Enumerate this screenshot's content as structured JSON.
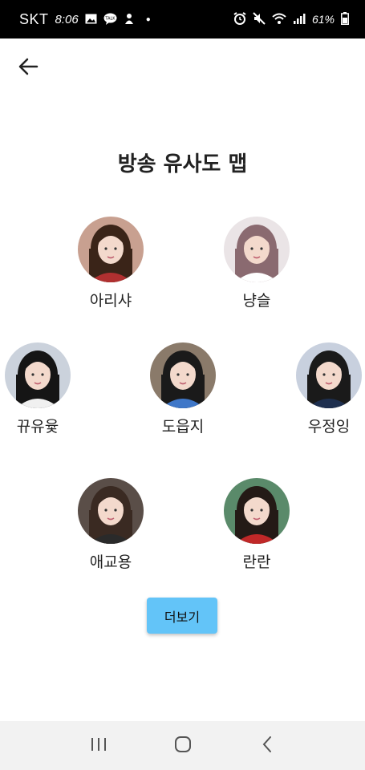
{
  "status_bar": {
    "carrier": "SKT",
    "time": "8:06",
    "battery_text": "61%",
    "left_icons": [
      "image-icon",
      "kakaotalk-icon",
      "notification-app-icon"
    ],
    "right_icons": [
      "alarm-icon",
      "mute-icon",
      "wifi-icon",
      "signal-icon",
      "battery-icon"
    ]
  },
  "header": {
    "back_icon": "arrow-left-icon"
  },
  "page": {
    "title": "방송 유사도 맵"
  },
  "streamers": [
    {
      "name": "아리샤",
      "hair": "#3a2418",
      "bg": "#c8a090",
      "accent": "#b03030"
    },
    {
      "name": "냥슬",
      "hair": "#8a6a70",
      "bg": "#eae4e6",
      "accent": "#ffffff"
    },
    {
      "name": "뀨유윷",
      "hair": "#151515",
      "bg": "#cbd2dc",
      "accent": "#f0f0f0"
    },
    {
      "name": "도읍지",
      "hair": "#1a1a1a",
      "bg": "#8a7a6a",
      "accent": "#3f77c8"
    },
    {
      "name": "우정잉",
      "hair": "#1a1a1a",
      "bg": "#c8d0de",
      "accent": "#1e2f4f"
    },
    {
      "name": "애교용",
      "hair": "#3a2a22",
      "bg": "#5a4e48",
      "accent": "#2a2a2a"
    },
    {
      "name": "란란",
      "hair": "#241a16",
      "bg": "#5a8a6a",
      "accent": "#c02828"
    }
  ],
  "actions": {
    "more_label": "더보기",
    "more_color": "#63c4f8"
  },
  "nav_bar": {
    "recents_icon": "recents-icon",
    "home_icon": "home-icon",
    "back_icon": "back-chevron-icon"
  }
}
